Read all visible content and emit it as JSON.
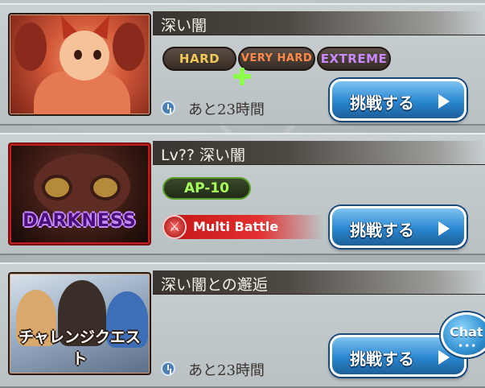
{
  "quests": [
    {
      "title": "深い闇",
      "thumbnail": "dragon-character-image",
      "difficulties": [
        {
          "label": "HARD",
          "color": "#f2c75a"
        },
        {
          "label": "VERY HARD",
          "color": "#ff8a4c"
        },
        {
          "label": "EXTREME",
          "color": "#c889ff"
        }
      ],
      "timer": "あと23時間",
      "button_label": "挑戦する"
    },
    {
      "title": "Lv?? 深い闇",
      "thumbnail": "darkness-monster-image",
      "thumbnail_label": "DARKNESS",
      "ap_cost": "AP-10",
      "battle_type": "Multi Battle",
      "button_label": "挑戦する"
    },
    {
      "title": "深い闇との邂逅",
      "thumbnail": "party-characters-image",
      "thumbnail_label": "チャレンジクエスト",
      "timer": "あと23時間",
      "button_label": "挑戦する"
    }
  ],
  "chat": {
    "label": "Chat",
    "dots": "•••"
  },
  "colors": {
    "accent_blue": "#2a86cf",
    "multi_red": "#c21414",
    "ap_green": "#a8ff5a"
  }
}
